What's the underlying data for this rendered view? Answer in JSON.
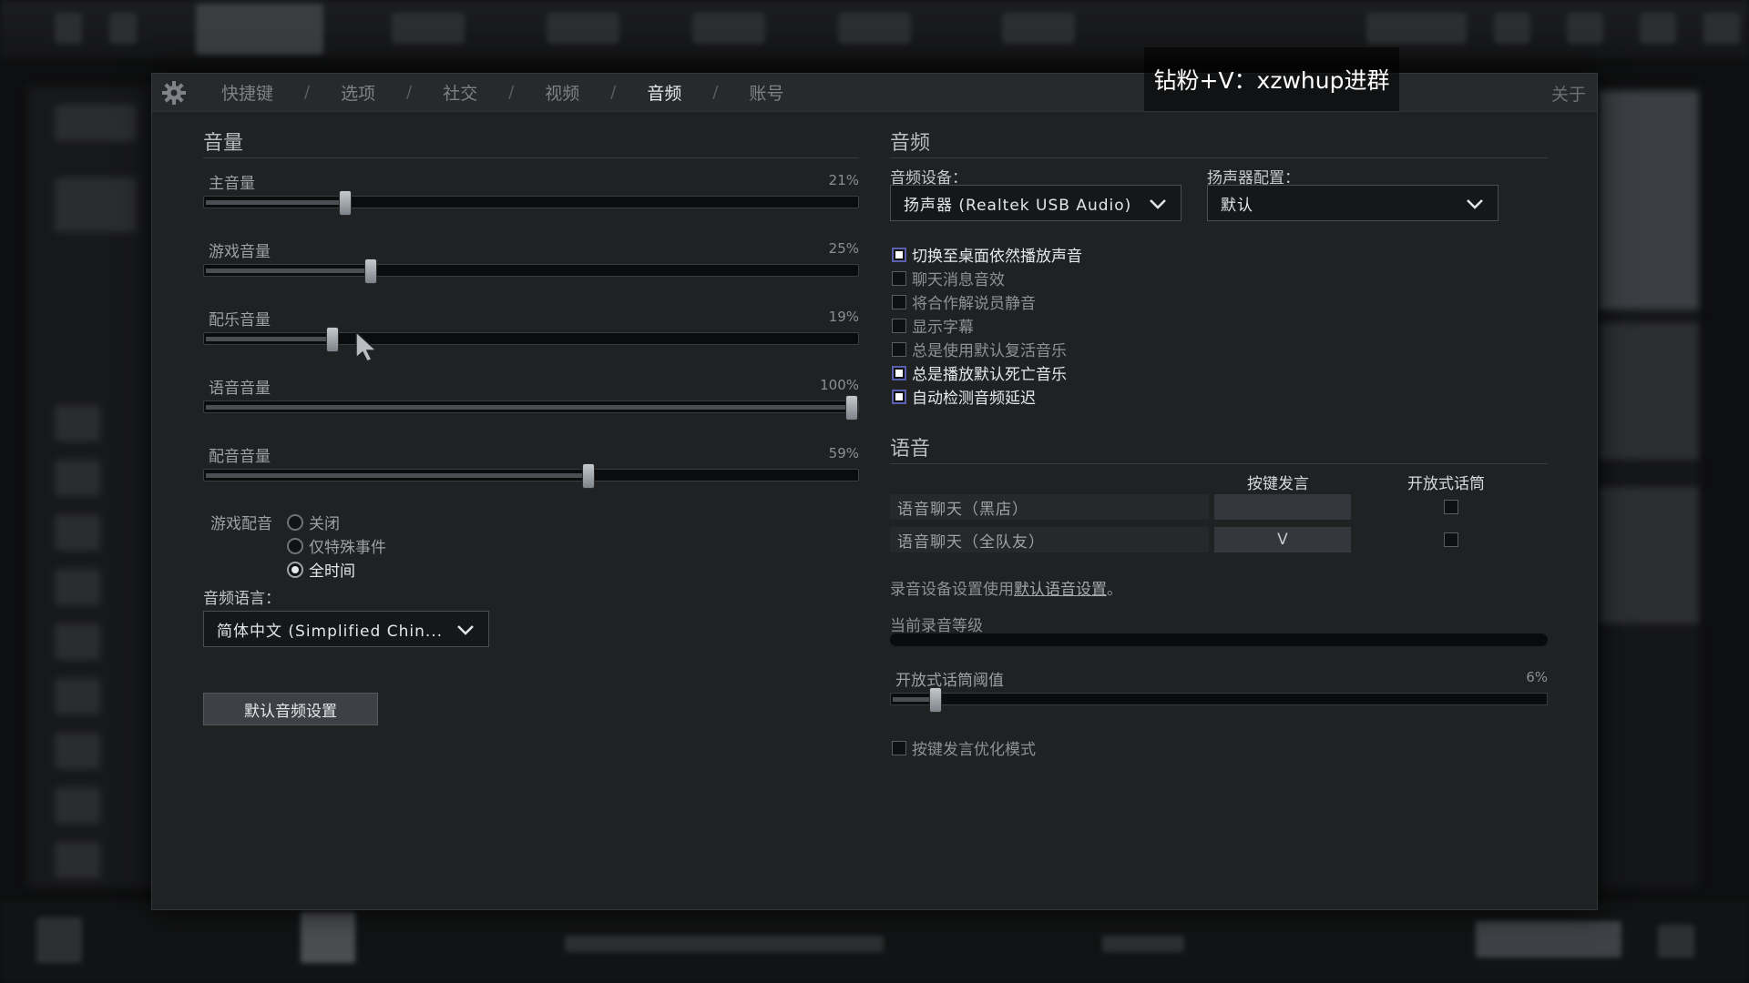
{
  "watermark": "钻粉+V：xzwhup进群",
  "nav": {
    "tabs": [
      "快捷键",
      "选项",
      "社交",
      "视频",
      "音频",
      "账号"
    ],
    "active_index": 4,
    "separator": "/",
    "close_label": "关于"
  },
  "volume": {
    "title": "音量",
    "sliders": [
      {
        "label": "主音量",
        "value_text": "21%",
        "value": 0.21
      },
      {
        "label": "游戏音量",
        "value_text": "25%",
        "value": 0.25
      },
      {
        "label": "配乐音量",
        "value_text": "19%",
        "value": 0.19
      },
      {
        "label": "语音音量",
        "value_text": "100%",
        "value": 1.0
      },
      {
        "label": "配音音量",
        "value_text": "59%",
        "value": 0.59
      }
    ],
    "announcer": {
      "label": "游戏配音",
      "options": [
        "关闭",
        "仅特殊事件",
        "全时间"
      ],
      "selected_index": 2
    },
    "language_label": "音频语言：",
    "language_value": "简体中文 (Simplified Chin...",
    "default_button": "默认音频设置"
  },
  "audio": {
    "title": "音频",
    "device_label": "音频设备：",
    "device_value": "扬声器 (Realtek USB Audio)",
    "speaker_label": "扬声器配置：",
    "speaker_value": "默认",
    "checkboxes": [
      {
        "label": "切换至桌面依然播放声音",
        "checked": true
      },
      {
        "label": "聊天消息音效",
        "checked": false
      },
      {
        "label": "将合作解说员静音",
        "checked": false
      },
      {
        "label": "显示字幕",
        "checked": false
      },
      {
        "label": "总是使用默认复活音乐",
        "checked": false
      },
      {
        "label": "总是播放默认死亡音乐",
        "checked": true
      },
      {
        "label": "自动检测音频延迟",
        "checked": true
      }
    ]
  },
  "voice": {
    "title": "语音",
    "col_push": "按键发言",
    "col_open": "开放式话筒",
    "rows": [
      {
        "label": "语音聊天（黑店）",
        "key": "",
        "open_mic": false
      },
      {
        "label": "语音聊天（全队友）",
        "key": "V",
        "open_mic": false
      }
    ],
    "note_prefix": "录音设备设置使用",
    "note_link": "默认语音设置",
    "note_suffix": "。",
    "level_label": "当前录音等级",
    "threshold_label": "开放式话筒阈值",
    "threshold_text": "6%",
    "threshold_value": 0.06,
    "ptt_opt_label": "按键发言优化模式",
    "ptt_opt_checked": false
  }
}
